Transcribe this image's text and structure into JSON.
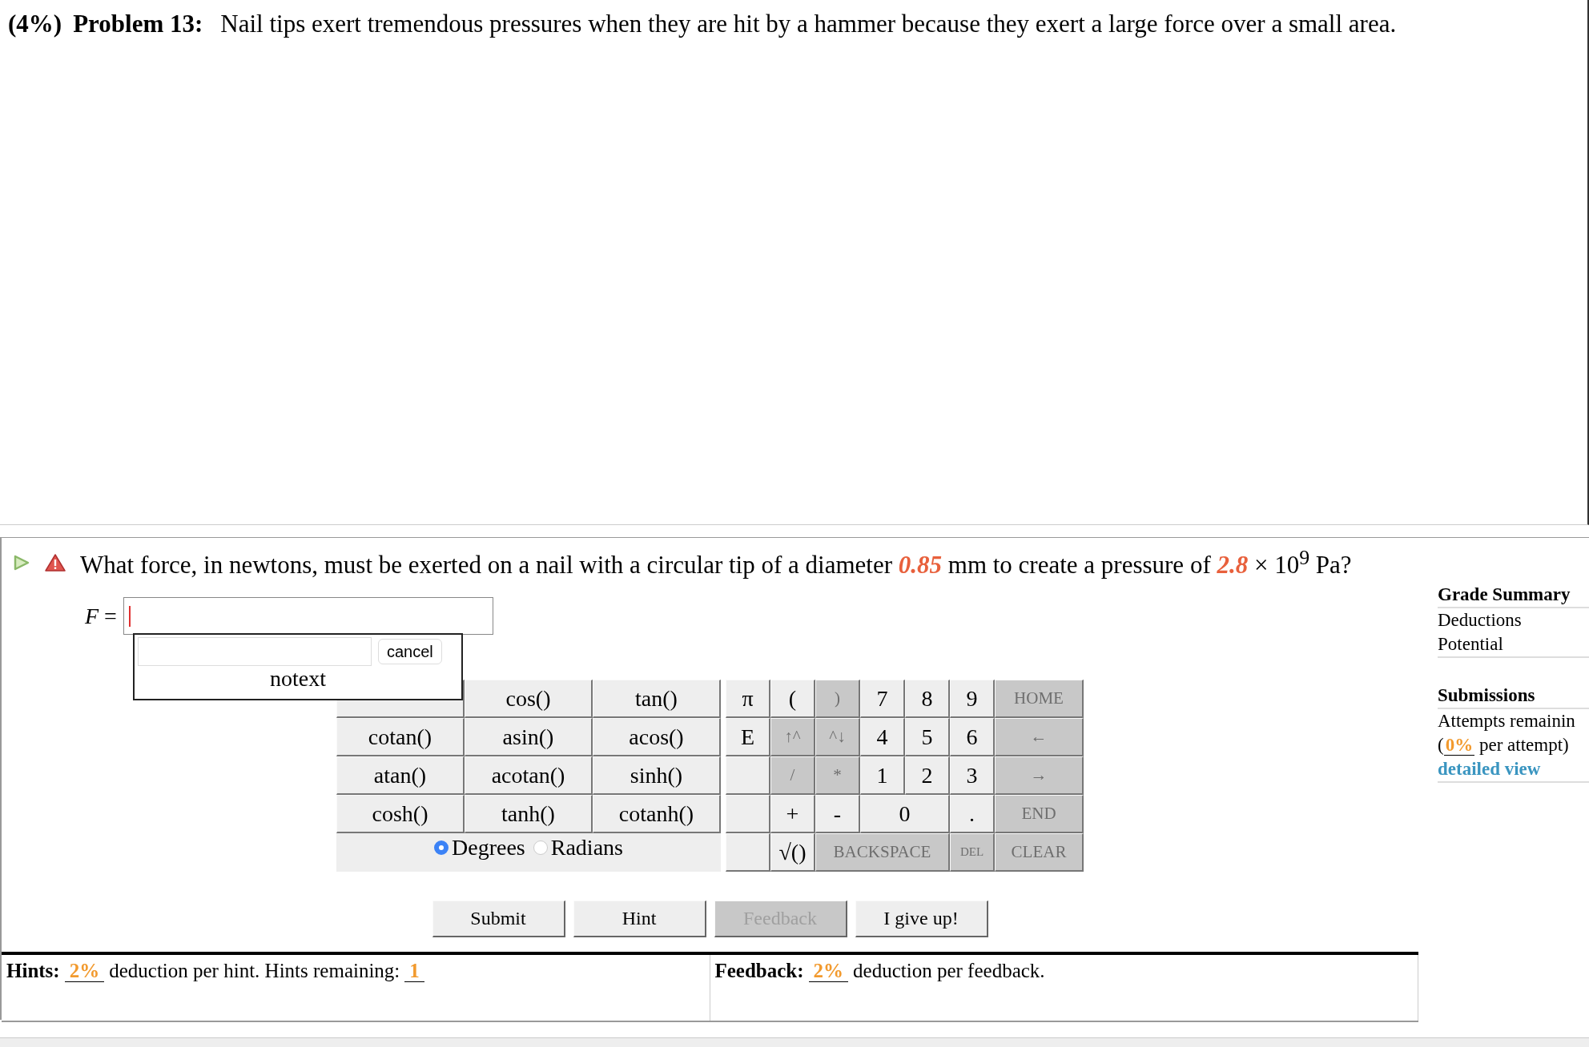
{
  "problem": {
    "weight": "(4%)",
    "label": "Problem 13:",
    "statement": "Nail tips exert tremendous pressures when they are hit by a hammer because they exert a large force over a small area."
  },
  "question": {
    "parts": [
      {
        "kind": "text",
        "text": "What force, in newtons, must be exerted on a nail with a circular tip of a diameter "
      },
      {
        "kind": "given",
        "text": "0.85"
      },
      {
        "kind": "text",
        "text": " mm to create a pressure of "
      },
      {
        "kind": "given",
        "text": "2.8"
      },
      {
        "kind": "text",
        "text": " × 10$^{9}$ Pa?"
      }
    ]
  },
  "answer": {
    "variable": "F",
    "relation": "="
  },
  "popup": {
    "cancel": "cancel",
    "message": "notext"
  },
  "keypad": {
    "functions": [
      {
        "kind": "covered"
      },
      {
        "kind": "key",
        "label": "cos()"
      },
      {
        "kind": "key",
        "label": "tan()"
      },
      {
        "kind": "key",
        "label": "cotan()"
      },
      {
        "kind": "key",
        "label": "asin()"
      },
      {
        "kind": "key",
        "label": "acos()"
      },
      {
        "kind": "key",
        "label": "atan()"
      },
      {
        "kind": "key",
        "label": "acotan()"
      },
      {
        "kind": "key",
        "label": "sinh()"
      },
      {
        "kind": "key",
        "label": "cosh()"
      },
      {
        "kind": "key",
        "label": "tanh()"
      },
      {
        "kind": "key",
        "label": "cotanh()"
      }
    ],
    "angle_modes": [
      {
        "label": "Degrees",
        "selected": true
      },
      {
        "label": "Radians",
        "selected": false
      }
    ],
    "keys": [
      {
        "kind": "key",
        "label": "π",
        "disabled": false
      },
      {
        "kind": "key",
        "label": "(",
        "disabled": false
      },
      {
        "kind": "key",
        "label": ")",
        "disabled": true
      },
      {
        "kind": "key",
        "label": "7",
        "disabled": false
      },
      {
        "kind": "key",
        "label": "8",
        "disabled": false
      },
      {
        "kind": "key",
        "label": "9",
        "disabled": false
      },
      {
        "kind": "key",
        "label": "HOME",
        "disabled": true
      },
      {
        "kind": "key",
        "label": "E",
        "disabled": false
      },
      {
        "kind": "key",
        "label": "↑^",
        "disabled": true
      },
      {
        "kind": "key",
        "label": "^↓",
        "disabled": true
      },
      {
        "kind": "key",
        "label": "4",
        "disabled": false
      },
      {
        "kind": "key",
        "label": "5",
        "disabled": false
      },
      {
        "kind": "key",
        "label": "6",
        "disabled": false
      },
      {
        "kind": "key",
        "label": "←",
        "disabled": true
      },
      {
        "kind": "blank"
      },
      {
        "kind": "key",
        "label": "/",
        "disabled": true
      },
      {
        "kind": "key",
        "label": "*",
        "disabled": true
      },
      {
        "kind": "key",
        "label": "1",
        "disabled": false
      },
      {
        "kind": "key",
        "label": "2",
        "disabled": false
      },
      {
        "kind": "key",
        "label": "3",
        "disabled": false
      },
      {
        "kind": "key",
        "label": "→",
        "disabled": true
      },
      {
        "kind": "blank"
      },
      {
        "kind": "key",
        "label": "+",
        "disabled": false
      },
      {
        "kind": "key",
        "label": "-",
        "disabled": false
      },
      {
        "kind": "double",
        "label": "0",
        "disabled": false
      },
      {
        "kind": "key",
        "label": ".",
        "disabled": false
      },
      {
        "kind": "key",
        "label": "END",
        "disabled": true
      },
      {
        "kind": "blank"
      },
      {
        "kind": "key",
        "label": "√()",
        "disabled": false
      },
      {
        "kind": "triple",
        "label": "BACKSPACE",
        "disabled": true
      },
      {
        "kind": "small",
        "label": "DEL",
        "disabled": true
      },
      {
        "kind": "key",
        "label": "CLEAR",
        "disabled": true
      }
    ]
  },
  "buttons": [
    {
      "label": "Submit",
      "disabled": false
    },
    {
      "label": "Hint",
      "disabled": false
    },
    {
      "label": "Feedback",
      "disabled": true
    },
    {
      "label": "I give up!",
      "disabled": false
    }
  ],
  "hints_bar": {
    "label": "Hints:",
    "deduction": "2%",
    "text": "deduction per hint. Hints remaining:",
    "remaining": "1"
  },
  "feedback_bar": {
    "label": "Feedback:",
    "deduction": "2%",
    "text": "deduction per feedback."
  },
  "grade_summary": {
    "title": "Grade Summary",
    "rows": [
      "Deductions",
      "Potential"
    ]
  },
  "submissions": {
    "title": "Submissions",
    "attempts": "Attempts remainin",
    "open": "(",
    "deduction": "0%",
    "per_attempt": "per attempt)",
    "link": "detailed view"
  }
}
